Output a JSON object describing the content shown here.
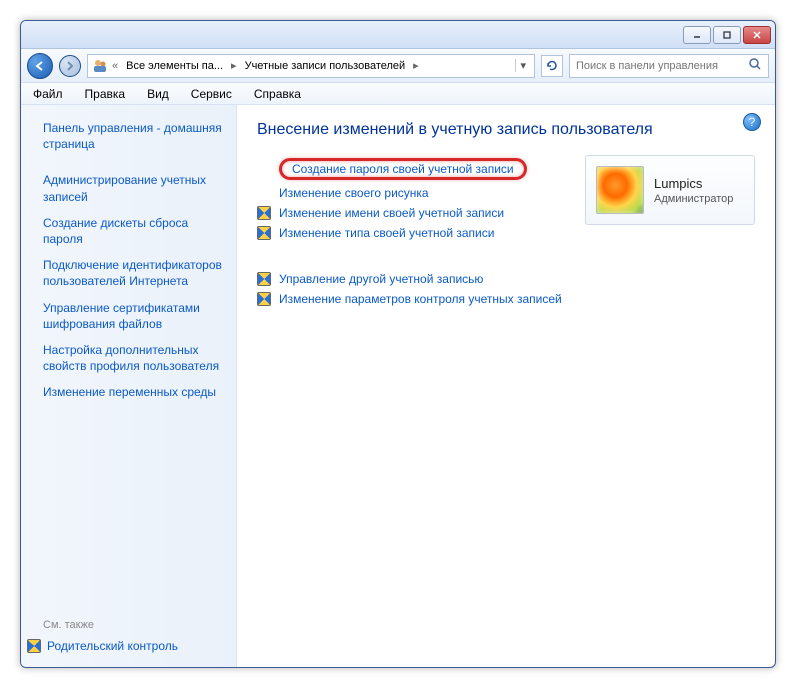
{
  "breadcrumb": {
    "items": [
      "Все элементы па...",
      "Учетные записи пользователей"
    ]
  },
  "search": {
    "placeholder": "Поиск в панели управления"
  },
  "menu": {
    "file": "Файл",
    "edit": "Правка",
    "view": "Вид",
    "service": "Сервис",
    "help": "Справка"
  },
  "sidebar": {
    "home": "Панель управления - домашняя страница",
    "links": [
      "Администрирование учетных записей",
      "Создание дискеты сброса пароля",
      "Подключение идентификаторов пользователей Интернета",
      "Управление сертификатами шифрования файлов",
      "Настройка дополнительных свойств профиля пользователя",
      "Изменение переменных среды"
    ],
    "also_label": "См. также",
    "parental": "Родительский контроль"
  },
  "main": {
    "title": "Внесение изменений в учетную запись пользователя",
    "actions_primary": [
      {
        "label": "Создание пароля своей учетной записи",
        "shield": false,
        "highlight": true
      },
      {
        "label": "Изменение своего рисунка",
        "shield": false
      },
      {
        "label": "Изменение имени своей учетной записи",
        "shield": true
      },
      {
        "label": "Изменение типа своей учетной записи",
        "shield": true
      }
    ],
    "actions_secondary": [
      {
        "label": "Управление другой учетной записью",
        "shield": true
      },
      {
        "label": "Изменение параметров контроля учетных записей",
        "shield": true
      }
    ],
    "user": {
      "name": "Lumpics",
      "role": "Администратор"
    }
  }
}
